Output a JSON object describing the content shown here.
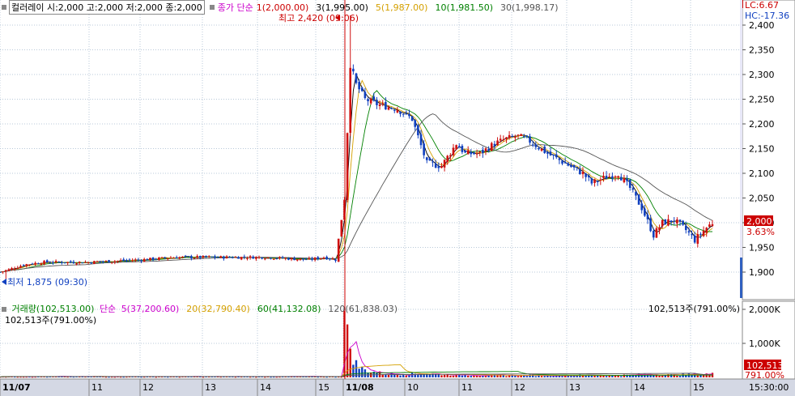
{
  "header": {
    "stock_info": "컬러레이 시:2,000 고:2,000 저:2,000 종:2,000",
    "price_ma_label": "종가 단순",
    "ma": [
      {
        "label": "1(2,000.00)",
        "color": "#cc0000"
      },
      {
        "label": "3(1,995.00)",
        "color": "#000000"
      },
      {
        "label": "5(1,987.00)",
        "color": "#d4a000"
      },
      {
        "label": "10(1,981.50)",
        "color": "#008000"
      },
      {
        "label": "30(1,998.17)",
        "color": "#555555"
      }
    ]
  },
  "annotations": {
    "high": "최고 2,420 (09:06)",
    "low": "최저 1,875 (09:30)"
  },
  "right_panel": {
    "lc": "LC:6.67",
    "hc": "HC:-17.36",
    "current_price": "2,000",
    "current_pct": "3.63%",
    "volume_value": "102,513",
    "volume_pct": "791.00%",
    "time": "15:30:00"
  },
  "volume_header": {
    "vol_label": "거래량(102,513.00)",
    "ma_label": "단순",
    "ma": [
      {
        "label": "5(37,200.60)",
        "color": "#cc00cc"
      },
      {
        "label": "20(32,790.40)",
        "color": "#d4a000"
      },
      {
        "label": "60(41,132.08)",
        "color": "#008000"
      },
      {
        "label": "120(61,838.03)",
        "color": "#555555"
      }
    ],
    "sub_label": "102,513주(791.00%)",
    "right_label": "102,513주(791.00%)"
  },
  "chart_data": {
    "type": "candlestick",
    "price_axis": {
      "ticks": [
        "2,400",
        "2,350",
        "2,300",
        "2,250",
        "2,200",
        "2,150",
        "2,100",
        "2,050",
        "2,000",
        "1,950",
        "1,900"
      ],
      "range": [
        1850,
        2420
      ]
    },
    "volume_axis": {
      "ticks": [
        "2,000K",
        "1,000K"
      ]
    },
    "x_ticks": [
      "11/07",
      "11",
      "12",
      "13",
      "14",
      "15",
      "11/08",
      "10",
      "11",
      "12",
      "13",
      "14",
      "15"
    ],
    "close_series": [
      {
        "t": 0,
        "v": 1900
      },
      {
        "t": 3,
        "v": 1905
      },
      {
        "t": 8,
        "v": 1915
      },
      {
        "t": 15,
        "v": 1920
      },
      {
        "t": 30,
        "v": 1920
      },
      {
        "t": 48,
        "v": 1925
      },
      {
        "t": 60,
        "v": 1930
      },
      {
        "t": 75,
        "v": 1930
      },
      {
        "t": 90,
        "v": 1930
      },
      {
        "t": 105,
        "v": 1925
      },
      {
        "t": 110,
        "v": 1930
      },
      {
        "t": 114,
        "v": 1925
      },
      {
        "t": 117,
        "v": 2050
      },
      {
        "t": 119,
        "v": 2320
      },
      {
        "t": 121,
        "v": 2280
      },
      {
        "t": 124,
        "v": 2250
      },
      {
        "t": 128,
        "v": 2240
      },
      {
        "t": 135,
        "v": 2230
      },
      {
        "t": 140,
        "v": 2210
      },
      {
        "t": 145,
        "v": 2120
      },
      {
        "t": 150,
        "v": 2115
      },
      {
        "t": 155,
        "v": 2160
      },
      {
        "t": 158,
        "v": 2140
      },
      {
        "t": 163,
        "v": 2140
      },
      {
        "t": 168,
        "v": 2160
      },
      {
        "t": 172,
        "v": 2170
      },
      {
        "t": 176,
        "v": 2175
      },
      {
        "t": 180,
        "v": 2165
      },
      {
        "t": 186,
        "v": 2140
      },
      {
        "t": 192,
        "v": 2120
      },
      {
        "t": 198,
        "v": 2100
      },
      {
        "t": 201,
        "v": 2080
      },
      {
        "t": 205,
        "v": 2090
      },
      {
        "t": 210,
        "v": 2100
      },
      {
        "t": 214,
        "v": 2070
      },
      {
        "t": 218,
        "v": 2030
      },
      {
        "t": 222,
        "v": 1975
      },
      {
        "t": 225,
        "v": 2000
      },
      {
        "t": 229,
        "v": 2005
      },
      {
        "t": 233,
        "v": 1985
      },
      {
        "t": 236,
        "v": 1965
      },
      {
        "t": 240,
        "v": 1990
      },
      {
        "t": 242,
        "v": 2000
      }
    ],
    "volume_series": [
      {
        "t": 117,
        "v": 1800
      },
      {
        "t": 118,
        "v": 1200
      },
      {
        "t": 119,
        "v": 900
      },
      {
        "t": 120,
        "v": 600
      },
      {
        "t": 121,
        "v": 400
      },
      {
        "t": 122,
        "v": 300
      },
      {
        "t": 124,
        "v": 220
      },
      {
        "t": 126,
        "v": 180
      },
      {
        "t": 128,
        "v": 140
      },
      {
        "t": 132,
        "v": 110
      },
      {
        "t": 138,
        "v": 90
      },
      {
        "t": 145,
        "v": 120
      },
      {
        "t": 152,
        "v": 80
      },
      {
        "t": 160,
        "v": 70
      },
      {
        "t": 170,
        "v": 60
      },
      {
        "t": 180,
        "v": 60
      },
      {
        "t": 190,
        "v": 55
      },
      {
        "t": 200,
        "v": 70
      },
      {
        "t": 210,
        "v": 60
      },
      {
        "t": 220,
        "v": 90
      },
      {
        "t": 230,
        "v": 70
      },
      {
        "t": 240,
        "v": 103
      }
    ]
  }
}
